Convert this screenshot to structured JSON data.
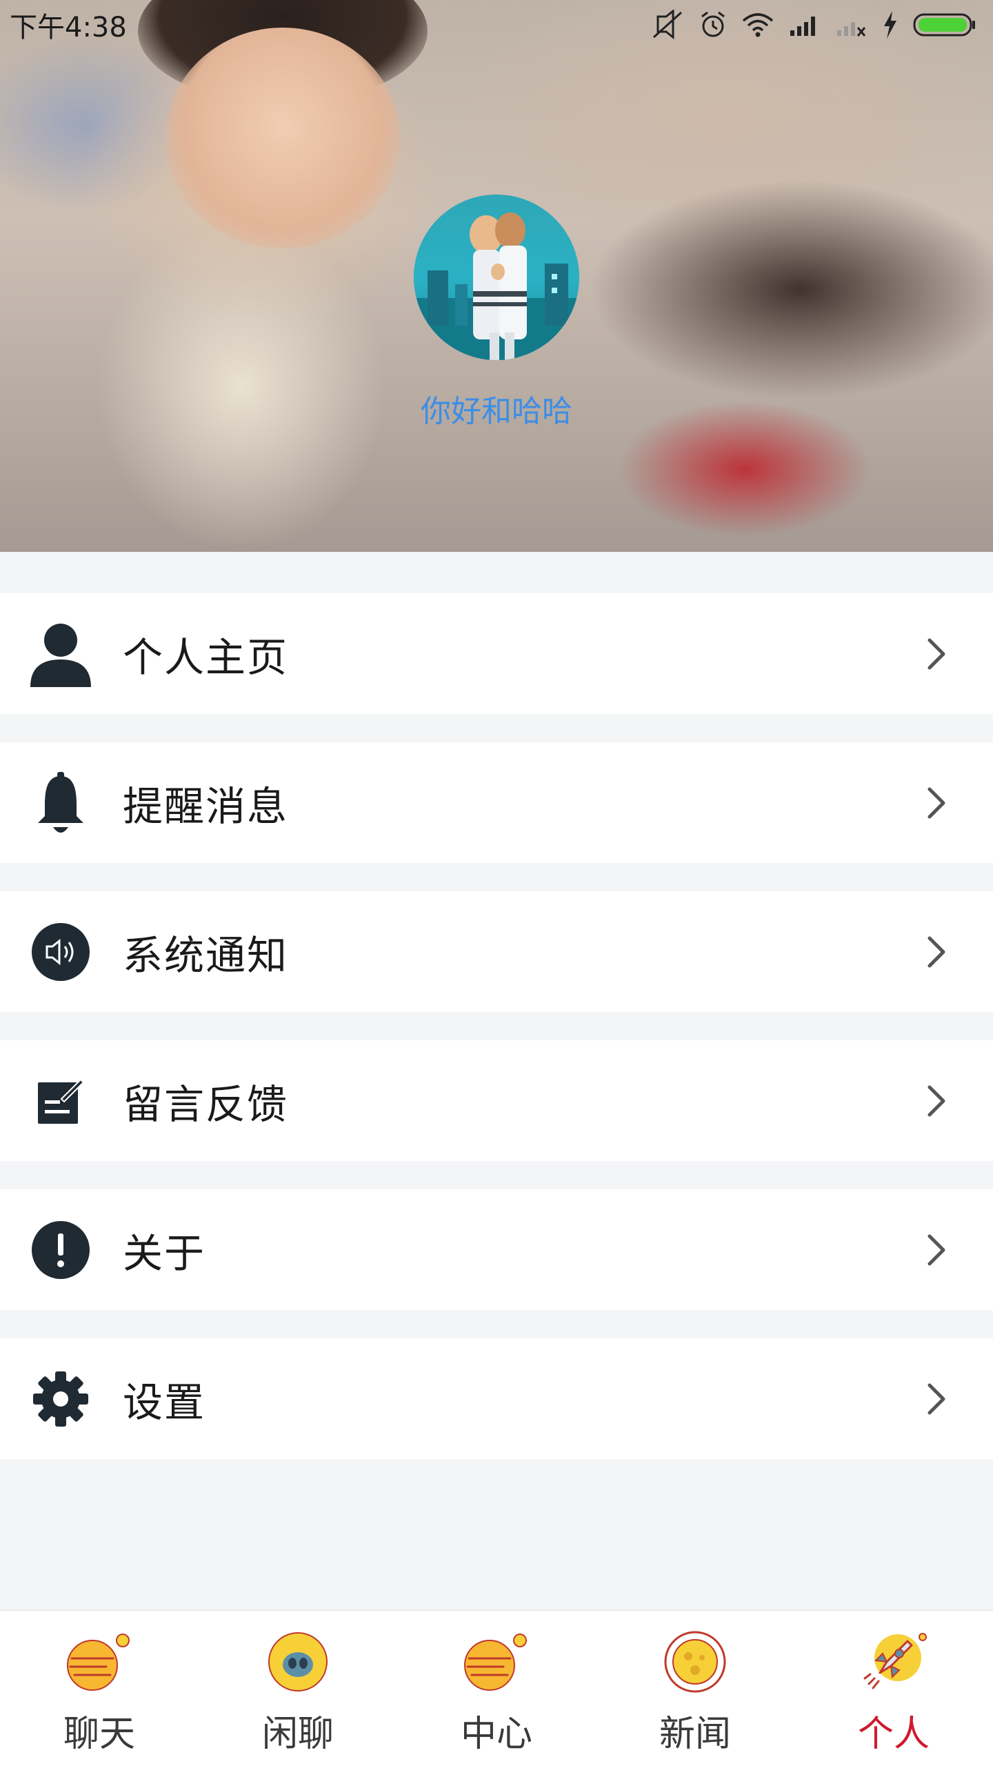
{
  "status_bar": {
    "time": "下午4:38"
  },
  "profile": {
    "nickname": "你好和哈哈"
  },
  "menu": [
    {
      "label": "个人主页",
      "icon": "person-icon"
    },
    {
      "label": "提醒消息",
      "icon": "bell-icon"
    },
    {
      "label": "系统通知",
      "icon": "speaker-icon"
    },
    {
      "label": "留言反馈",
      "icon": "edit-note-icon"
    },
    {
      "label": "关于",
      "icon": "exclamation-icon"
    },
    {
      "label": "设置",
      "icon": "gear-icon"
    }
  ],
  "tabs": [
    {
      "label": "聊天",
      "icon": "planet-icon",
      "active": false
    },
    {
      "label": "闲聊",
      "icon": "alien-icon",
      "active": false
    },
    {
      "label": "中心",
      "icon": "planet-icon",
      "active": false
    },
    {
      "label": "新闻",
      "icon": "moon-icon",
      "active": false
    },
    {
      "label": "个人",
      "icon": "rocket-icon",
      "active": true
    }
  ],
  "colors": {
    "accent_active": "#d0192d",
    "nickname": "#3b8ee6",
    "icon_dark": "#1f2a33",
    "background": "#f4f5f7"
  }
}
